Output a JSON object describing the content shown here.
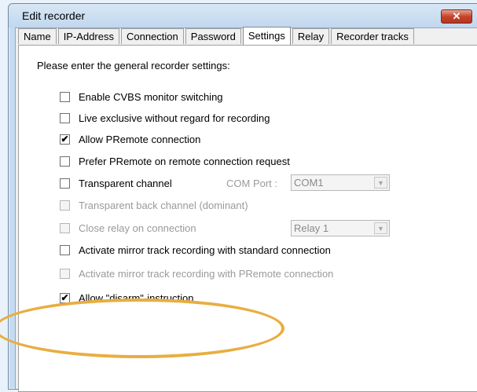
{
  "window": {
    "title": "Edit recorder",
    "close_label": "✕"
  },
  "tabs": [
    {
      "label": "Name",
      "active": false
    },
    {
      "label": "IP-Address",
      "active": false
    },
    {
      "label": "Connection",
      "active": false
    },
    {
      "label": "Password",
      "active": false
    },
    {
      "label": "Settings",
      "active": true
    },
    {
      "label": "Relay",
      "active": false
    },
    {
      "label": "Recorder tracks",
      "active": false
    }
  ],
  "settings": {
    "intro": "Please enter the general recorder settings:",
    "options": [
      {
        "label": "Enable CVBS monitor switching",
        "checked": false,
        "enabled": true
      },
      {
        "label": "Live exclusive without regard for recording",
        "checked": false,
        "enabled": true
      },
      {
        "label": "Allow PRemote connection",
        "checked": true,
        "enabled": true
      },
      {
        "label": "Prefer PRemote on remote connection request",
        "checked": false,
        "enabled": true
      },
      {
        "label": "Transparent channel",
        "checked": false,
        "enabled": true
      },
      {
        "label": "Transparent back channel (dominant)",
        "checked": false,
        "enabled": false
      },
      {
        "label": "Close relay on connection",
        "checked": false,
        "enabled": false
      },
      {
        "label": "Activate mirror track recording with standard connection",
        "checked": false,
        "enabled": true
      },
      {
        "label": "Activate mirror track recording with PRemote connection",
        "checked": false,
        "enabled": false
      },
      {
        "label": "Allow \"disarm\"-instruction",
        "checked": true,
        "enabled": true
      }
    ],
    "com_port": {
      "label": "COM Port :",
      "value": "COM1"
    },
    "relay_select": {
      "value": "Relay 1"
    }
  },
  "colors": {
    "highlight_oval": "#e8ae40",
    "close_button": "#c7432a"
  }
}
